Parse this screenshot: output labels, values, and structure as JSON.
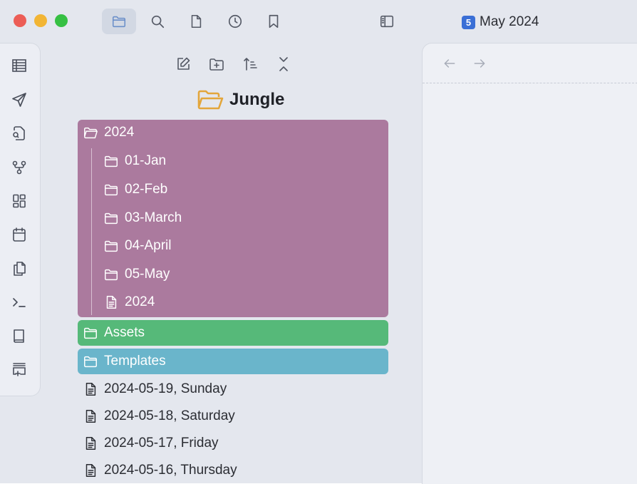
{
  "window": {
    "title_number": "5",
    "title": "May 2024"
  },
  "toolbar": {
    "tabs": [
      {
        "name": "files-icon",
        "active": true
      },
      {
        "name": "search-icon",
        "active": false
      },
      {
        "name": "file-icon",
        "active": false
      },
      {
        "name": "clock-icon",
        "active": false
      },
      {
        "name": "bookmark-icon",
        "active": false
      }
    ],
    "sidebar_toggle": "sidebar-toggle-icon"
  },
  "ribbon": {
    "items": [
      "table-icon",
      "send-icon",
      "file-search-icon",
      "git-fork-icon",
      "dashboard-icon",
      "calendar-icon",
      "copy-icon",
      "terminal-icon",
      "book-icon",
      "new-tab-icon"
    ]
  },
  "file_pane": {
    "actions": [
      "new-note-icon",
      "new-folder-icon",
      "sort-icon",
      "collapse-icon"
    ],
    "vault_name": "Jungle",
    "folder_2024": {
      "label": "2024",
      "color": "#ab7a9e",
      "children": [
        {
          "type": "folder",
          "label": "01-Jan"
        },
        {
          "type": "folder",
          "label": "02-Feb"
        },
        {
          "type": "folder",
          "label": "03-March"
        },
        {
          "type": "folder",
          "label": "04-April"
        },
        {
          "type": "folder",
          "label": "05-May"
        },
        {
          "type": "file",
          "label": "2024"
        }
      ]
    },
    "assets": {
      "label": "Assets",
      "color": "#56b979"
    },
    "templates": {
      "label": "Templates",
      "color": "#6ab5cb"
    },
    "files": [
      "2024-05-19, Sunday",
      "2024-05-18, Saturday",
      "2024-05-17, Friday",
      "2024-05-16, Thursday"
    ]
  },
  "editor": {
    "back": "arrow-left-icon",
    "forward": "arrow-right-icon"
  }
}
